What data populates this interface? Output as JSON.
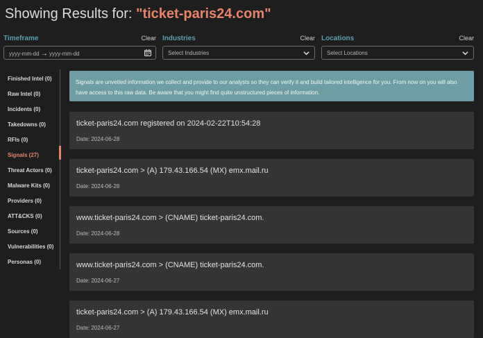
{
  "header": {
    "prefix": "Showing Results for:",
    "query": "\"ticket-paris24.com\""
  },
  "filters": {
    "timeframe": {
      "label": "Timeframe",
      "clear": "Clear",
      "start_placeholder": "yyyy-mm-dd",
      "arrow": "→",
      "end_placeholder": "yyyy-mm-dd"
    },
    "industries": {
      "label": "Industries",
      "clear": "Clear",
      "placeholder": "Select Industries"
    },
    "locations": {
      "label": "Locations",
      "clear": "Clear",
      "placeholder": "Select Locations"
    }
  },
  "sidebar": {
    "items": [
      {
        "label": "Finished Intel (0)"
      },
      {
        "label": "Raw Intel (0)"
      },
      {
        "label": "Incidents (0)"
      },
      {
        "label": "Takedowns (0)"
      },
      {
        "label": "RFIs (0)"
      },
      {
        "label": "Signals (27)"
      },
      {
        "label": "Threat Actors (0)"
      },
      {
        "label": "Malware Kits (0)"
      },
      {
        "label": "Providers (0)"
      },
      {
        "label": "ATT&CKS (0)"
      },
      {
        "label": "Sources (0)"
      },
      {
        "label": "Vulnerabilities (0)"
      },
      {
        "label": "Personas (0)"
      }
    ],
    "active": "Signals (27)"
  },
  "info_banner": "Signals are unvetted information we collect and provide to our analysts so they can verify it and build tailored intelligence for you. From now on you will also have access to this raw data. Be aware that you might find quite unstructured pieces of information.",
  "results": [
    {
      "title": "ticket-paris24.com registered on 2024-02-22T10:54:28",
      "date": "Date: 2024-06-28"
    },
    {
      "title": "ticket-paris24.com > (A) 179.43.166.54 (MX) emx.mail.ru",
      "date": "Date: 2024-06-28"
    },
    {
      "title": "www.ticket-paris24.com > (CNAME) ticket-paris24.com.",
      "date": "Date: 2024-06-28"
    },
    {
      "title": "www.ticket-paris24.com > (CNAME) ticket-paris24.com.",
      "date": "Date: 2024-06-27"
    },
    {
      "title": "ticket-paris24.com > (A) 179.43.166.54 (MX) emx.mail.ru",
      "date": "Date: 2024-06-27"
    }
  ]
}
